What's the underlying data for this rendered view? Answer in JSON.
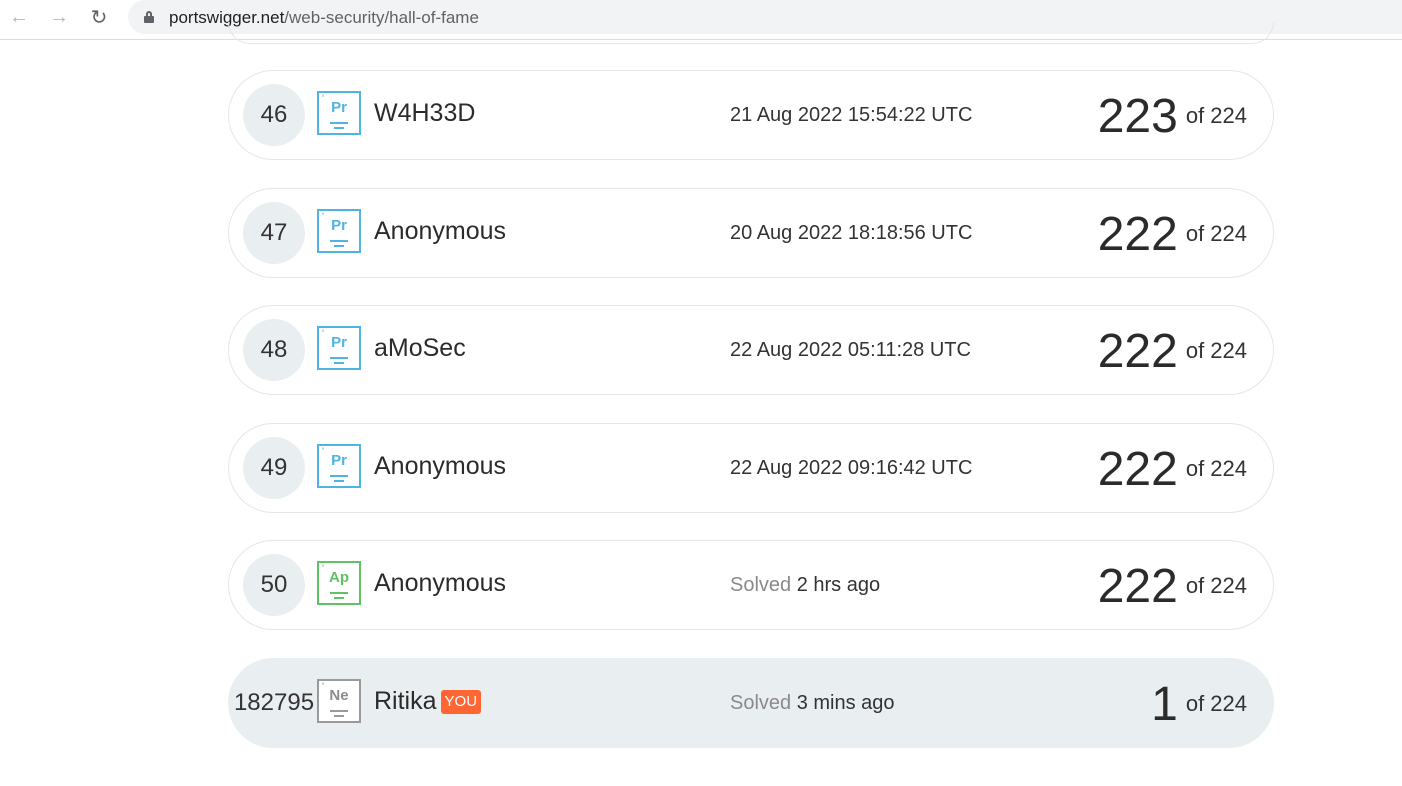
{
  "browser": {
    "url_host": "portswigger.net",
    "url_path": "/web-security/hall-of-fame"
  },
  "leaderboard": {
    "rows": [
      {
        "rank": "46",
        "level": "Pr",
        "name": "W4H33D",
        "date": "21 Aug 2022 15:54:22 UTC",
        "score": "223",
        "total": "of 224"
      },
      {
        "rank": "47",
        "level": "Pr",
        "name": "Anonymous",
        "date": "20 Aug 2022 18:18:56 UTC",
        "score": "222",
        "total": "of 224"
      },
      {
        "rank": "48",
        "level": "Pr",
        "name": "aMoSec",
        "date": "22 Aug 2022 05:11:28 UTC",
        "score": "222",
        "total": "of 224"
      },
      {
        "rank": "49",
        "level": "Pr",
        "name": "Anonymous",
        "date": "22 Aug 2022 09:16:42 UTC",
        "score": "222",
        "total": "of 224"
      },
      {
        "rank": "50",
        "level": "Ap",
        "name": "Anonymous",
        "solved_label": "Solved",
        "solved_time": "2 hrs ago",
        "score": "222",
        "total": "of 224"
      }
    ],
    "you_row": {
      "rank": "182795",
      "level": "Ne",
      "name": "Ritika",
      "badge": "YOU",
      "solved_label": "Solved",
      "solved_time": "3 mins ago",
      "score": "1",
      "total": "of 224"
    }
  },
  "colors": {
    "practitioner": "#4fb3e3",
    "apprentice": "#61c265",
    "newcomer": "#9a9a9a",
    "you_badge": "#ff6633",
    "you_row_bg": "#e9eef1"
  }
}
